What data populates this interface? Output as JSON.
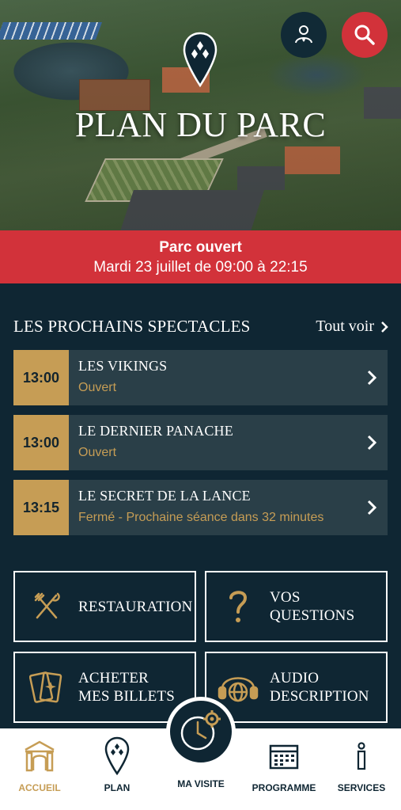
{
  "hero": {
    "title": "PLAN DU PARC"
  },
  "status": {
    "title": "Parc ouvert",
    "hours": "Mardi 23 juillet de 09:00 à 22:15"
  },
  "shows": {
    "heading": "LES PROCHAINS SPECTACLES",
    "see_all": "Tout voir",
    "items": [
      {
        "time": "13:00",
        "name": "LES VIKINGS",
        "status": "Ouvert"
      },
      {
        "time": "13:00",
        "name": "LE DERNIER PANACHE",
        "status": "Ouvert"
      },
      {
        "time": "13:15",
        "name": "LE SECRET DE LA LANCE",
        "status": "Fermé - Prochaine séance dans 32 minutes"
      }
    ]
  },
  "tiles": {
    "restauration": {
      "line1": "RESTAURATION",
      "line2": ""
    },
    "questions": {
      "line1": "VOS",
      "line2": "QUESTIONS"
    },
    "billets": {
      "line1": "ACHETER",
      "line2": "MES BILLETS"
    },
    "audio": {
      "line1": "AUDIO",
      "line2": "DESCRIPTION"
    }
  },
  "nav": {
    "accueil": "ACCUEIL",
    "plan": "PLAN",
    "visite": "MA VISITE",
    "programme": "PROGRAMME",
    "services": "SERVICES",
    "active": "accueil"
  },
  "colors": {
    "navy": "#0f2633",
    "gold": "#c69d55",
    "red": "#d2323a",
    "card": "#2a3f48"
  },
  "icons": [
    "person-pin-icon",
    "search-icon",
    "map-pin-icon",
    "chevron-right-icon",
    "cutlery-icon",
    "question-mark-icon",
    "tickets-icon",
    "audio-globe-icon",
    "home-gate-icon",
    "clock-gear-icon",
    "calendar-icon",
    "info-icon"
  ]
}
